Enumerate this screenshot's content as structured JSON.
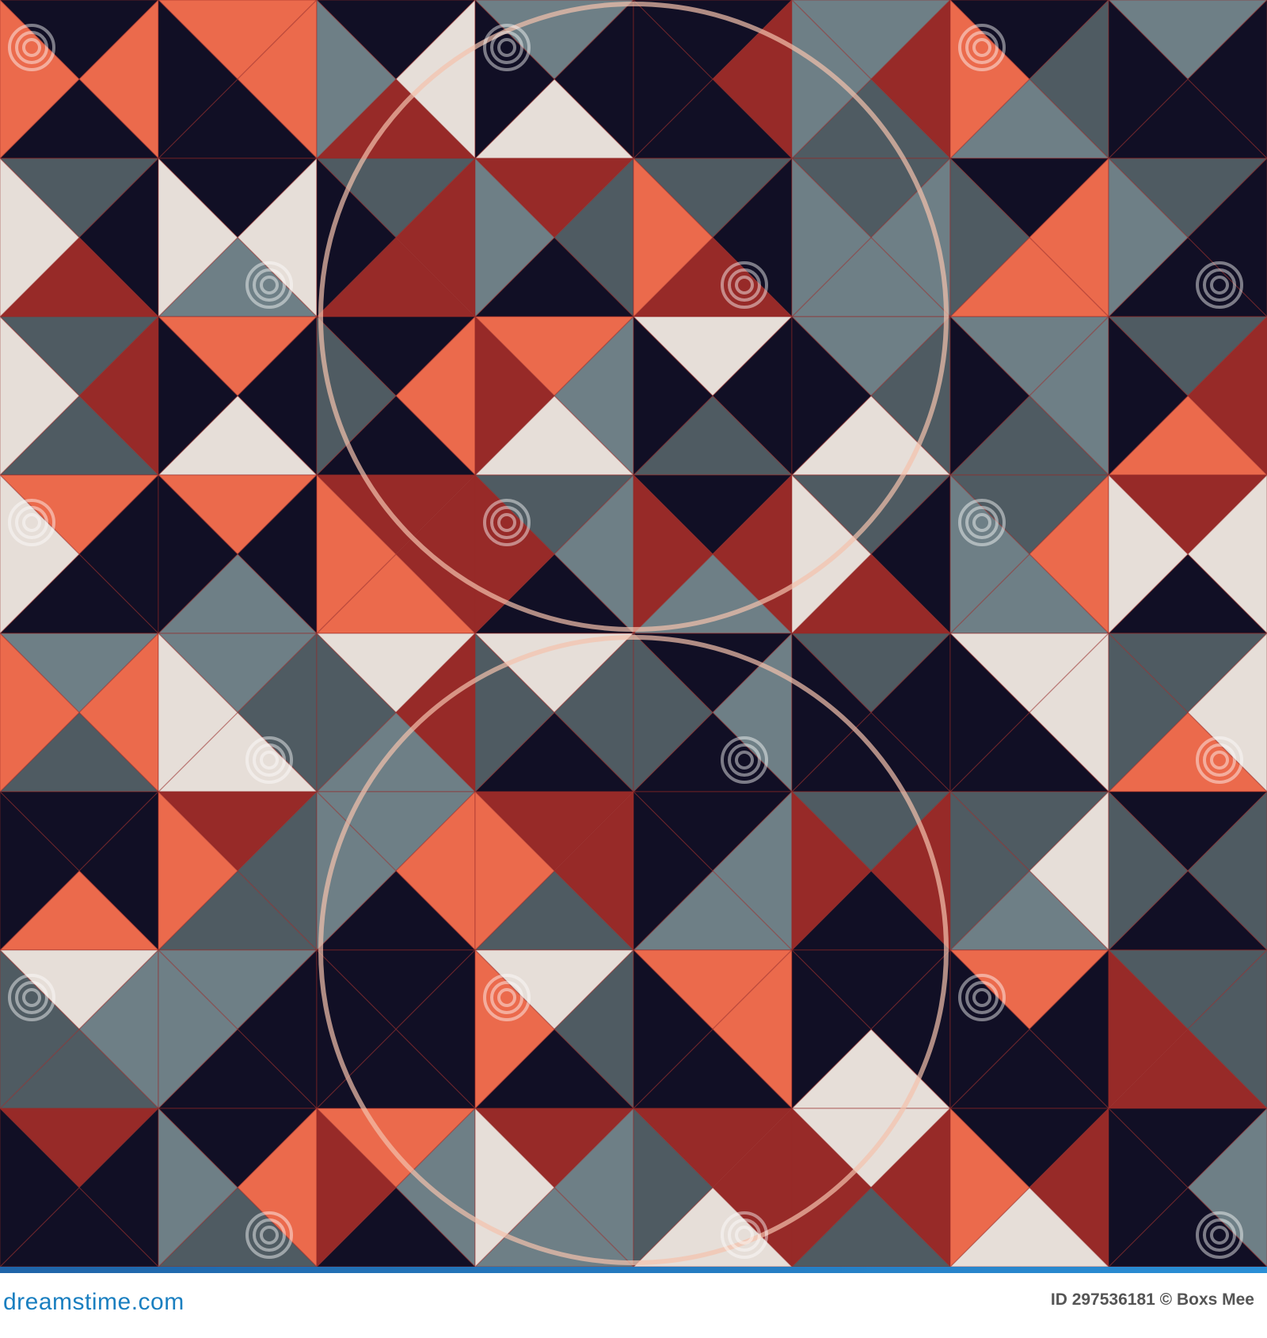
{
  "watermark": {
    "text": "dreamstime",
    "color": "#ffffff"
  },
  "footer": {
    "brand": "dreamstime.com",
    "image_id": "ID 297536181 © Boxs Mee"
  },
  "palette": {
    "navy": "#110f25",
    "coral": "#eb6a4c",
    "red": "#972a28",
    "cream": "#e6ded8",
    "gray": "#6e7f86",
    "slate": "#4f5b62",
    "peach": "#f4c2ad"
  }
}
